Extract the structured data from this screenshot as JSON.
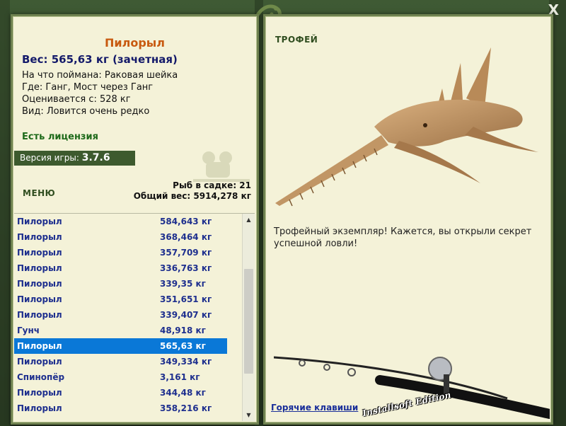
{
  "window": {
    "close_label": "X"
  },
  "fish": {
    "name": "Пилорыл",
    "weight": "Вес: 565,63 кг (зачетная)",
    "lines": [
      "На что поймана: Раковая шейка",
      "Где: Ганг, Мост через Ганг",
      "Оценивается с: 528 кг",
      "Вид: Ловится очень редко"
    ]
  },
  "license": "Есть лицензия",
  "version": {
    "label": "Версия игры: ",
    "value": "3.7.6"
  },
  "menu_label": "МЕНЮ",
  "bag": {
    "count": "Рыб в садке: 21",
    "total": "Общий вес: 5914,278 кг"
  },
  "catches": [
    {
      "name": "Пилорыл",
      "weight": "584,643 кг"
    },
    {
      "name": "Пилорыл",
      "weight": "368,464 кг"
    },
    {
      "name": "Пилорыл",
      "weight": "357,709 кг"
    },
    {
      "name": "Пилорыл",
      "weight": "336,763 кг"
    },
    {
      "name": "Пилорыл",
      "weight": "339,35 кг"
    },
    {
      "name": "Пилорыл",
      "weight": "351,651 кг"
    },
    {
      "name": "Пилорыл",
      "weight": "339,407 кг"
    },
    {
      "name": "Гунч",
      "weight": "48,918 кг"
    },
    {
      "name": "Пилорыл",
      "weight": "565,63 кг",
      "selected": true
    },
    {
      "name": "Пилорыл",
      "weight": "349,334 кг"
    },
    {
      "name": "Спинопёр",
      "weight": "3,161 кг"
    },
    {
      "name": "Пилорыл",
      "weight": "344,48 кг"
    },
    {
      "name": "Пилорыл",
      "weight": "358,216 кг"
    }
  ],
  "trophy": {
    "title": "ТРОФЕЙ",
    "text": "Трофейный экземпляр! Кажется, вы открыли секрет успешной ловли!"
  },
  "hotkeys_label": "Горячие клавиши",
  "edition_label": "Installsoft Edition",
  "colors": {
    "panel_bg": "#f4f2d8",
    "border": "#6f8250",
    "selected": "#0a78d7",
    "name_orange": "#c85a10"
  }
}
